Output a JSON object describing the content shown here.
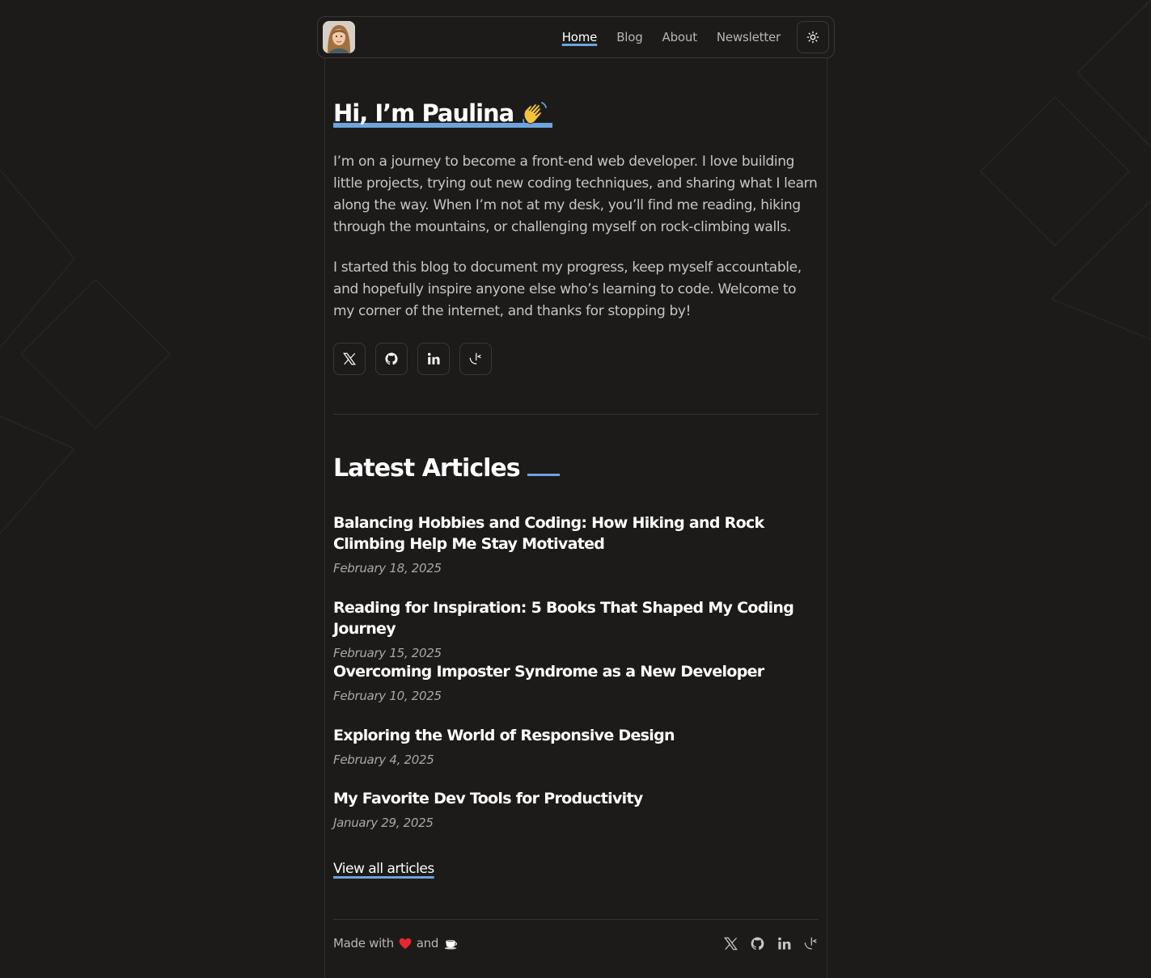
{
  "nav": {
    "links": [
      "Home",
      "Blog",
      "About",
      "Newsletter"
    ],
    "active": "Home"
  },
  "hero": {
    "title": "Hi, I’m Paulina",
    "emoji": "waving-hand",
    "paragraphs": [
      "I’m on a journey to become a front-end web developer. I love building little projects, trying out new coding techniques, and sharing what I learn along the way. When I’m not at my desk, you’ll find me reading, hiking through the mountains, or challenging myself on rock-climbing walls.",
      "I started this blog to document my progress, keep myself accountable, and hopefully inspire anyone else who’s learning to code. Welcome to my corner of the internet, and thanks for stopping by!"
    ]
  },
  "socials": [
    "x-icon",
    "github-icon",
    "linkedin-icon",
    "frontend-mentor-icon"
  ],
  "latest": {
    "title": "Latest Articles",
    "articles": [
      {
        "title": "Balancing Hobbies and Coding: How Hiking and Rock Climbing Help Me Stay Motivated",
        "date": "February 18, 2025"
      },
      {
        "title": "Reading for Inspiration: 5 Books That Shaped My Coding Journey",
        "date": "February 15, 2025"
      },
      {
        "title": "Overcoming Imposter Syndrome as a New Developer",
        "date": "February 10, 2025"
      },
      {
        "title": "Exploring the World of Responsive Design",
        "date": "February 4, 2025"
      },
      {
        "title": "My Favorite Dev Tools for Productivity",
        "date": "January 29, 2025"
      }
    ],
    "view_all": "View all articles"
  },
  "footer": {
    "made_with": "Made with",
    "and": "and"
  },
  "colors": {
    "background": "#1c1b1a",
    "accent": "#6ea4dd",
    "border": "#3a3836",
    "heading": "#ffffff",
    "text": "#c8c5c2"
  }
}
